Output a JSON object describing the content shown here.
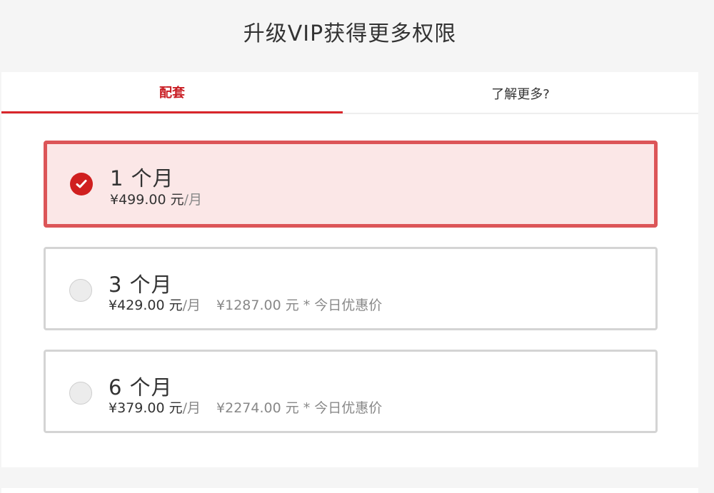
{
  "header": {
    "title": "升级VIP获得更多权限"
  },
  "tabs": [
    {
      "label": "配套"
    },
    {
      "label": "了解更多?"
    }
  ],
  "plans": [
    {
      "title": "1 个月",
      "price": "¥499.00 元",
      "unit": "/月",
      "original": "",
      "selected": true
    },
    {
      "title": "3 个月",
      "price": "¥429.00 元",
      "unit": "/月",
      "original": "¥1287.00 元 * 今日优惠价",
      "selected": false
    },
    {
      "title": "6 个月",
      "price": "¥379.00 元",
      "unit": "/月",
      "original": "¥2274.00 元 * 今日优惠价",
      "selected": false
    }
  ],
  "colors": {
    "accent": "#d9262b",
    "selected_bg": "#fbe7e7",
    "selected_border": "#dc5558"
  }
}
